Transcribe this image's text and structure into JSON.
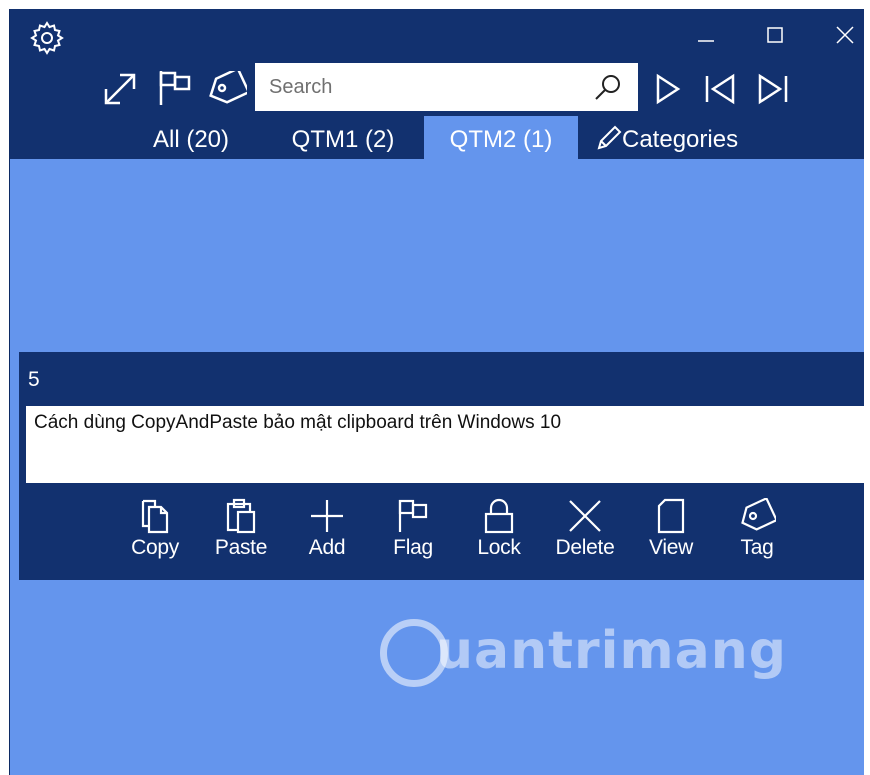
{
  "titlebar": {
    "settings_icon": "gear-icon",
    "minimize_icon": "minimize-icon",
    "maximize_icon": "maximize-icon",
    "close_icon": "close-icon"
  },
  "toolbar": {
    "expand_icon": "expand-diagonal-icon",
    "flag_icon": "flag-icon",
    "tag_icon": "tag-icon",
    "search": {
      "placeholder": "Search",
      "value": "",
      "icon": "search-icon"
    },
    "play_icon": "play-icon",
    "first_icon": "skip-previous-icon",
    "last_icon": "skip-next-icon"
  },
  "tabs": [
    {
      "label": "All (20)",
      "active": false
    },
    {
      "label": "QTM1 (2)",
      "active": false
    },
    {
      "label": "QTM2 (1)",
      "active": true
    },
    {
      "label": "Categories",
      "active": false,
      "icon": "pencil-icon"
    }
  ],
  "item": {
    "number": "5",
    "content": "Cách dùng CopyAndPaste bảo mật clipboard trên Windows 10",
    "actions": [
      {
        "label": "Copy",
        "icon": "copy-icon"
      },
      {
        "label": "Paste",
        "icon": "paste-icon"
      },
      {
        "label": "Add",
        "icon": "add-icon"
      },
      {
        "label": "Flag",
        "icon": "flag-icon"
      },
      {
        "label": "Lock",
        "icon": "lock-icon"
      },
      {
        "label": "Delete",
        "icon": "delete-icon"
      },
      {
        "label": "View",
        "icon": "view-icon"
      },
      {
        "label": "Tag",
        "icon": "tag-icon"
      }
    ]
  },
  "watermark": {
    "text": "uantrimang"
  },
  "colors": {
    "titlebar_bg": "#12316f",
    "content_bg": "#6495ed",
    "active_tab_bg": "#6495ed",
    "card_bg": "#12316f"
  }
}
